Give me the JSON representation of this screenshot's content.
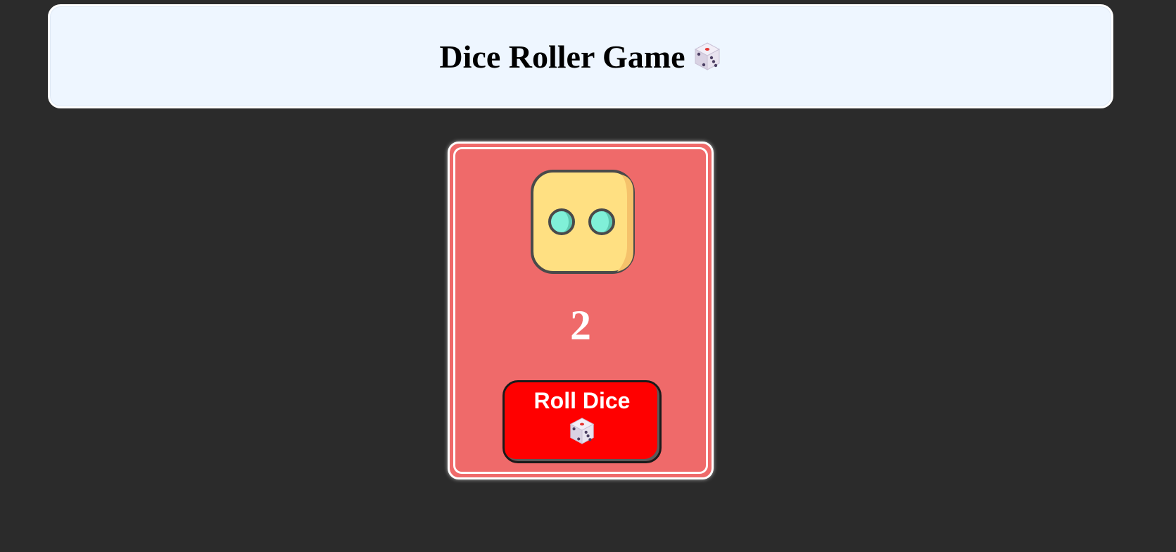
{
  "header": {
    "title": "Dice Roller Game",
    "title_icon": "dice-icon"
  },
  "game": {
    "die_face_value": 2,
    "result": "2",
    "roll_button": {
      "label": "Roll Dice",
      "icon": "dice-icon"
    }
  },
  "colors": {
    "page_background": "#2b2b2b",
    "header_background": "#eef6ff",
    "card_background": "#ef6a6a",
    "button_background": "#ff0000",
    "die_face": "#ffe082",
    "die_pips": "#80f0d8"
  }
}
